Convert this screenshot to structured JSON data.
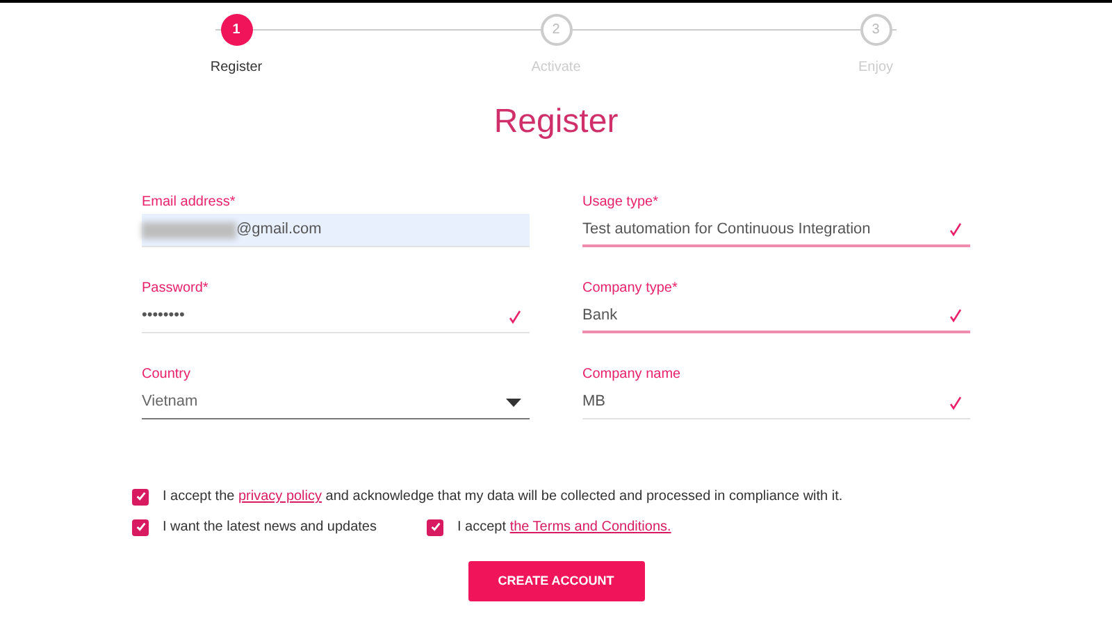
{
  "steps": [
    {
      "number": "1",
      "label": "Register",
      "selected": true
    },
    {
      "number": "2",
      "label": "Activate",
      "selected": false
    },
    {
      "number": "3",
      "label": "Enjoy",
      "selected": false
    }
  ],
  "title": "Register",
  "columns": [
    [
      {
        "kind": "text",
        "label": "Email address*",
        "value": "@gmail.com",
        "obscured": true,
        "autofilled": true,
        "valid": false,
        "highlighted": false
      },
      {
        "kind": "text",
        "label": "Password*",
        "value": "••••••••",
        "obscured": false,
        "autofilled": false,
        "valid": true,
        "highlighted": false
      },
      {
        "kind": "select",
        "label": "Country",
        "value": "Vietnam",
        "obscured": false,
        "autofilled": false,
        "valid": false,
        "highlighted": false
      }
    ],
    [
      {
        "kind": "text",
        "label": "Usage type*",
        "value": "Test automation for Continuous Integration",
        "obscured": false,
        "autofilled": false,
        "valid": true,
        "highlighted": true
      },
      {
        "kind": "text",
        "label": "Company type*",
        "value": "Bank",
        "obscured": false,
        "autofilled": false,
        "valid": true,
        "highlighted": true
      },
      {
        "kind": "text",
        "label": "Company name",
        "value": "MB",
        "obscured": false,
        "autofilled": false,
        "valid": true,
        "highlighted": false
      }
    ]
  ],
  "consents": [
    [
      {
        "checked": true,
        "before": "I accept the ",
        "link": "privacy policy",
        "after": " and acknowledge that my data will be collected and processed in compliance with it."
      }
    ],
    [
      {
        "checked": true,
        "before": "I want the latest news and updates"
      },
      {
        "checked": true,
        "before": "I accept ",
        "link": "the Terms and Conditions."
      }
    ]
  ],
  "submit": "CREATE ACCOUNT"
}
